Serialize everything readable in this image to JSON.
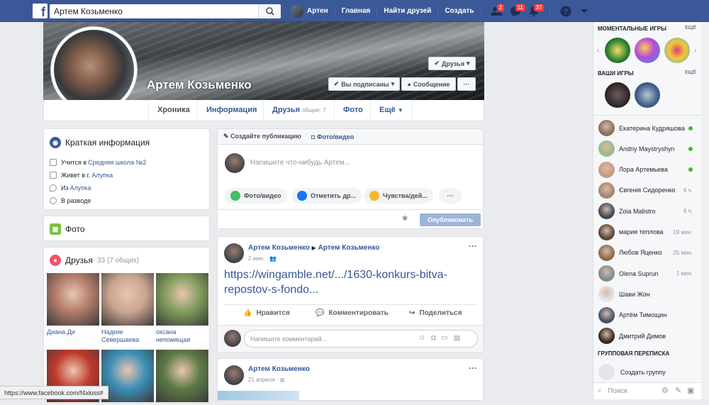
{
  "topbar": {
    "logo": "f",
    "search_value": "Артем Козьменко",
    "user_name": "Артен",
    "home": "Главная",
    "find_friends": "Найти друзей",
    "create": "Создать",
    "friend_requests_count": "2",
    "messages_count": "11",
    "notifications_count": "37"
  },
  "profile": {
    "name": "Артем Козьменко",
    "friends_button": "Друзья",
    "following_button": "Вы подписаны",
    "message_button": "Сообщение",
    "more_button": "···"
  },
  "tabs": {
    "timeline": "Хроника",
    "about": "Информация",
    "friends": "Друзья",
    "friends_common": "общие: 7",
    "photos": "Фото",
    "more": "Ещё"
  },
  "intro": {
    "title": "Краткая информация",
    "study_prefix": "Учится в ",
    "study_link": "Средняя школа №2",
    "lives_prefix": "Живет в г. ",
    "lives_link": "Алупка",
    "from_prefix": "Из ",
    "from_link": "Алупка",
    "relationship": "В разводе"
  },
  "photos_card": {
    "title": "Фото"
  },
  "friends_card": {
    "title": "Друзья",
    "count": " · 33 (7 общих)",
    "friends": [
      {
        "name": "Диана Ди",
        "color": "#b07a6a"
      },
      {
        "name": "Надкие Севершаева",
        "color": "#c9a48f"
      },
      {
        "name": "оксана непомящая",
        "color": "#7e9b5a"
      },
      {
        "name": "",
        "color": "#c0392b"
      },
      {
        "name": "",
        "color": "#3b8fb5"
      },
      {
        "name": "",
        "color": "#5d7a45"
      }
    ]
  },
  "composer": {
    "create_post": "Создайте публикацию",
    "photo_video_tab": "Фото/видео",
    "placeholder": "Напишите что-нибудь Артем...",
    "photo_video": "Фото/видео",
    "tag_friends": "Отметить др...",
    "feeling": "Чувства/дей...",
    "more": "···",
    "publish": "Опубликовать"
  },
  "post1": {
    "author": "Артем Козьменко",
    "target": "Артем Козьменко",
    "time": "2 мин.",
    "link_text": "https://wingamble.net/.../1630-konkurs-bitva-repostov-s-fondo...",
    "like": "Нравится",
    "comment": "Комментировать",
    "share": "Поделиться",
    "comment_placeholder": "Напишите комментарий..."
  },
  "post2": {
    "author": "Артем Козьменко",
    "time": "21 апреля"
  },
  "sidebar": {
    "instant_games": "МОМЕНТАЛЬНЫЕ ИГРЫ",
    "more1": "ЕЩЁ",
    "your_games": "ВАШИ ИГРЫ",
    "more2": "ЕЩЁ",
    "group_chats": "ГРУППОВАЯ ПЕРЕПИСКА",
    "create_group": "Создать группу",
    "search_placeholder": "Поиск",
    "chats": [
      {
        "name": "Екатерина Кудряшова",
        "time": "",
        "online": true,
        "color": "#8a6e60"
      },
      {
        "name": "Andriy Maystryshyn",
        "time": "",
        "online": true,
        "color": "#9bb98a"
      },
      {
        "name": "Лора Артемьева",
        "time": "",
        "online": true,
        "color": "#c79b85"
      },
      {
        "name": "Євгенія Сидоренко",
        "time": "6 ч.",
        "online": false,
        "color": "#a58470"
      },
      {
        "name": "Zoia Malistro",
        "time": "6 ч.",
        "online": false,
        "color": "#3c4a55"
      },
      {
        "name": "мария теплова",
        "time": "19 мин.",
        "online": false,
        "color": "#5a4638"
      },
      {
        "name": "Любов Яценко",
        "time": "25 мин.",
        "online": false,
        "color": "#8c6a4a"
      },
      {
        "name": "Olena Suprun",
        "time": "1 мин.",
        "online": false,
        "color": "#7c8c92"
      },
      {
        "name": "Шави Жон",
        "time": "",
        "online": false,
        "color": "#e4e6eb"
      },
      {
        "name": "Артём Тимощин",
        "time": "",
        "online": false,
        "color": "#44546a"
      },
      {
        "name": "Дмитрий Димов",
        "time": "",
        "online": false,
        "color": "#2f2a1f"
      }
    ]
  },
  "statusbar": {
    "url": "https://www.facebook.com/f4xkiss#"
  }
}
